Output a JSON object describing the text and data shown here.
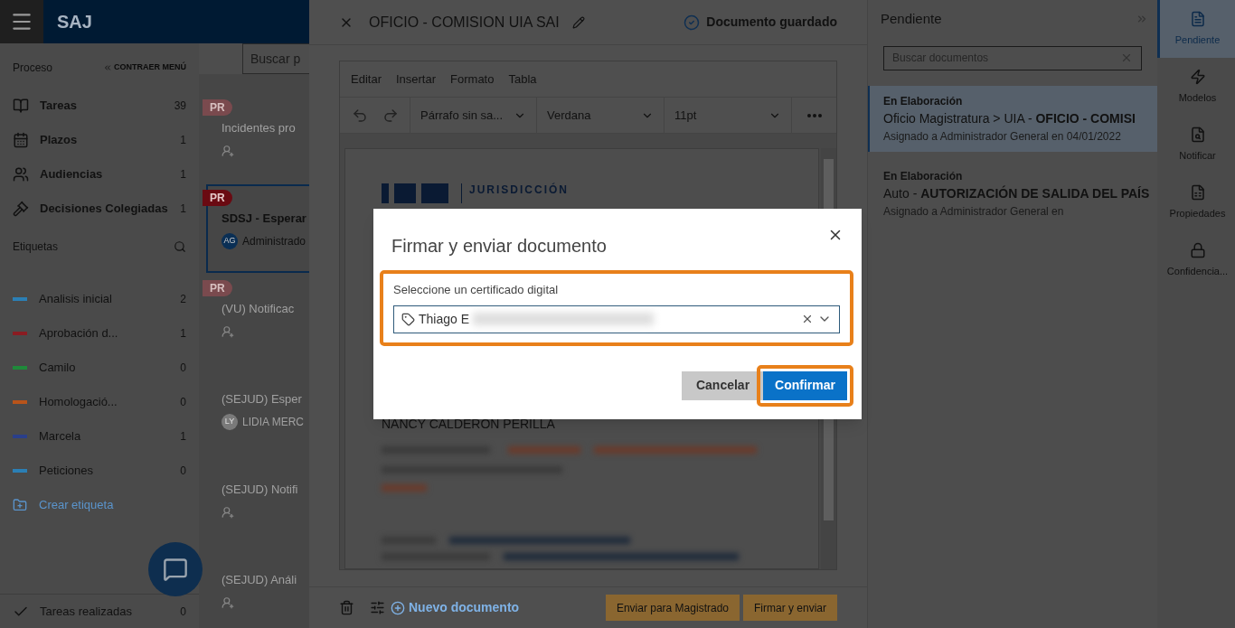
{
  "app": {
    "logo": "SAJ"
  },
  "sidebar": {
    "section_title": "Proceso",
    "collapse": "CONTRAER MENÚ",
    "items": [
      {
        "kind": "tasks",
        "label": "Tareas",
        "count": "39"
      },
      {
        "kind": "deadlines",
        "label": "Plazos",
        "count": "1"
      },
      {
        "kind": "hearings",
        "label": "Audiencias",
        "count": "1"
      },
      {
        "kind": "decisions",
        "label": "Decisiones Colegiadas",
        "count": "1"
      }
    ],
    "tags_title": "Etiquetas",
    "tags": [
      {
        "label": "Analisis inicial",
        "count": "2",
        "color": "#2b7fb5"
      },
      {
        "label": "Aprobación d...",
        "count": "1",
        "color": "#8a1c22"
      },
      {
        "label": "Camilo",
        "count": "0",
        "color": "#1f8a3a"
      },
      {
        "label": "Homologació...",
        "count": "0",
        "color": "#b8541a"
      },
      {
        "label": "Marcela",
        "count": "1",
        "color": "#2a3f8a"
      },
      {
        "label": "Peticiones",
        "count": "0",
        "color": "#2b7fb5"
      }
    ],
    "create_tag": "Crear etiqueta",
    "footer": {
      "label": "Tareas realizadas",
      "count": "0"
    }
  },
  "tasks": {
    "search_placeholder": "Buscar p",
    "cards": [
      {
        "badge": "PR",
        "title": "Incidentes pro",
        "selected": false
      },
      {
        "badge": "PR",
        "title": "SDSJ - Esperar",
        "assignee": {
          "initials": "AG",
          "name": "Administrado"
        },
        "selected": true
      },
      {
        "badge": "PR",
        "title": "(VU) Notificac",
        "selected": false
      },
      {
        "title": "(SEJUD) Esper",
        "assignee": {
          "initials": "LY",
          "name": "LIDIA MERC"
        },
        "selected": false
      },
      {
        "title": "(SEJUD) Notifi",
        "selected": false
      },
      {
        "title": "(SEJUD) Análi",
        "selected": false
      }
    ]
  },
  "editor": {
    "title": "OFICIO - COMISION UIA SAI",
    "saved_status": "Documento guardado",
    "menu": [
      "Editar",
      "Insertar",
      "Formato",
      "Tabla"
    ],
    "toolbar": {
      "paragraph": "Párrafo sin sa...",
      "font": "Verdana",
      "size": "11pt"
    },
    "document": {
      "logo_text": "JURISDICCIÓN",
      "name": "NANCY CALDERON PERILLA"
    },
    "new_document": "Nuevo documento",
    "actions": [
      "Enviar para Magistrado",
      "Firmar y enviar"
    ]
  },
  "pending": {
    "title": "Pendiente",
    "search_placeholder": "Buscar documentos",
    "documents": [
      {
        "status": "En Elaboración",
        "title": "Oficio Magistratura > UIA - **OFICIO - COMISI**",
        "assigned": "Asignado a Administrador General en 04/01/2022",
        "selected": true
      },
      {
        "status": "En Elaboración",
        "title": "Auto - **AUTORIZACIÓN DE SALIDA DEL PAÍS**",
        "assigned": "Asignado a Administrador General en",
        "selected": false
      }
    ]
  },
  "rail": [
    {
      "kind": "pending",
      "label": "Pendiente",
      "selected": true
    },
    {
      "kind": "models",
      "label": "Modelos",
      "selected": false
    },
    {
      "kind": "notify",
      "label": "Notificar",
      "selected": false
    },
    {
      "kind": "properties",
      "label": "Propiedades",
      "selected": false
    },
    {
      "kind": "confidential",
      "label": "Confidencia...",
      "selected": false
    }
  ],
  "dialog": {
    "title": "Firmar y enviar documento",
    "field_label": "Seleccione un certificado digital",
    "value": "Thiago E",
    "field_highlighted": true,
    "cancel": "Cancelar",
    "confirm": "Confirmar",
    "confirm_highlighted": true
  }
}
